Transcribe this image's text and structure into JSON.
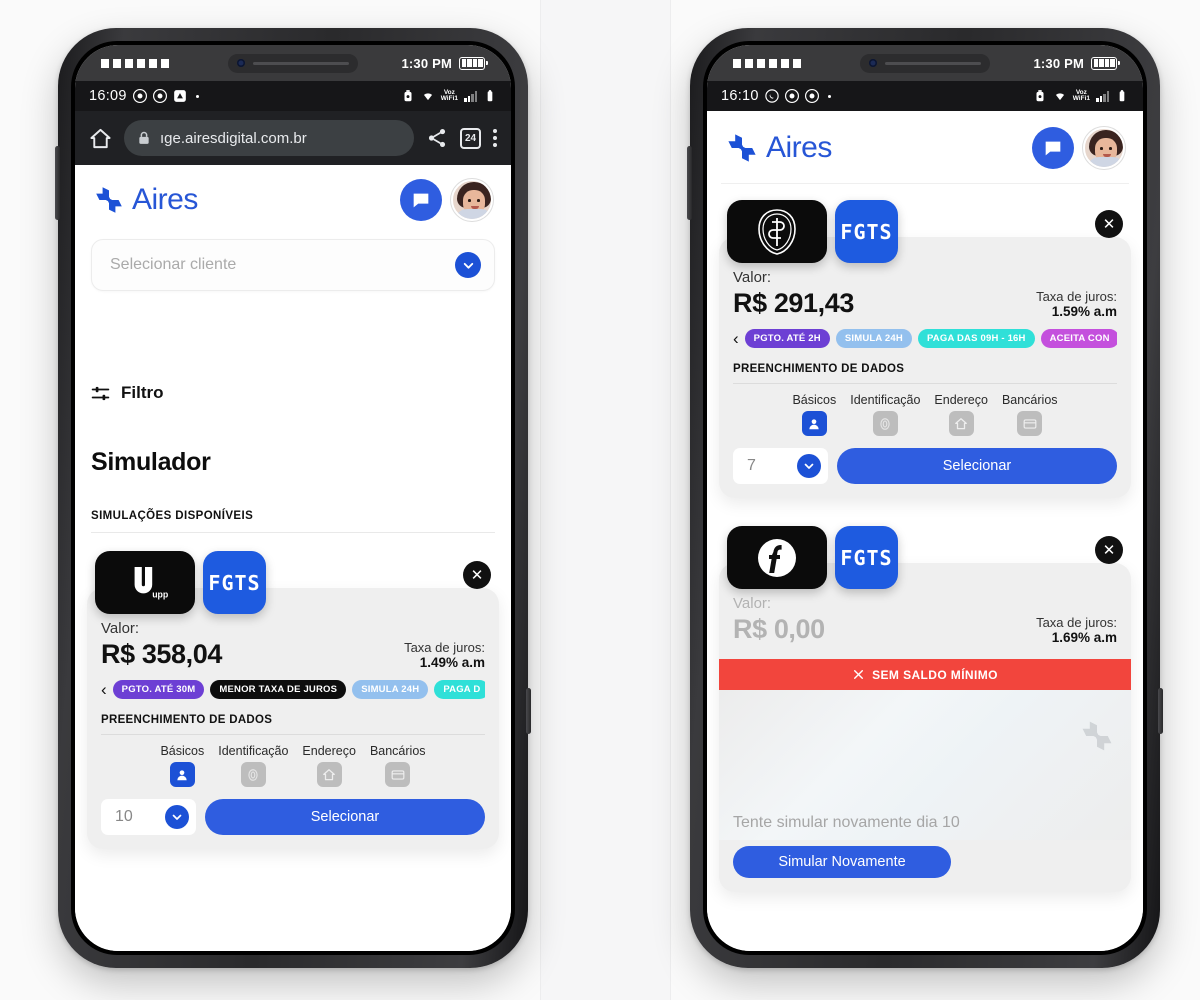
{
  "left_phone": {
    "device_status": {
      "time": "1:30 PM",
      "battery_icon": "battery-full-icon"
    },
    "android_status": {
      "time": "16:09",
      "icons": [
        "chrome-icon",
        "chrome-icon",
        "app-icon"
      ],
      "right_icons": [
        "alarm-icon",
        "wifi-icon",
        "voice-wifi-icon",
        "signal-icon",
        "battery-icon"
      ],
      "voz_label": "Voz",
      "wifi_label": "WiFi1"
    },
    "browser": {
      "home_icon": "home-icon",
      "lock_icon": "lock-icon",
      "url": "ıge.airesdigital.com.br",
      "share_icon": "share-icon",
      "tab_count": "24",
      "menu_icon": "kebab-menu-icon"
    },
    "app": {
      "brand": "Aires",
      "logo_icon": "aires-pinwheel-logo",
      "chat_icon": "chat-bubble-icon",
      "avatar_icon": "user-avatar",
      "client_select": {
        "placeholder": "Selecionar cliente",
        "chevron_icon": "chevron-down-icon"
      },
      "filter": {
        "label": "Filtro",
        "icon": "filter-sliders-icon"
      },
      "page_title": "Simulador",
      "section_caption": "SIMULAÇÕES DISPONÍVEIS",
      "offer": {
        "bank_logo": "upp-logo",
        "bank_name": "upp",
        "product_logo": "fgts-logo",
        "product_name": "FGTS",
        "close_icon": "close-icon",
        "value_label": "Valor:",
        "value": "R$ 358,04",
        "rate_label": "Taxa de juros:",
        "rate": "1.49% a.m",
        "prev_icon": "chevron-left-icon",
        "next_icon": "chevron-right-icon",
        "tags": [
          {
            "label": "PGTO. ATÉ 30M",
            "color": "#6d3fd4"
          },
          {
            "label": "MENOR TAXA DE JUROS",
            "color": "#0d0d0d"
          },
          {
            "label": "SIMULA 24H",
            "color": "#93c0ee"
          },
          {
            "label": "PAGA D",
            "color": "#2fe0d8"
          }
        ],
        "fill_title": "PREENCHIMENTO DE DADOS",
        "steps": [
          {
            "label": "Básicos",
            "icon": "person-icon",
            "active": true
          },
          {
            "label": "Identificação",
            "icon": "fingerprint-icon",
            "active": false
          },
          {
            "label": "Endereço",
            "icon": "home-icon",
            "active": false
          },
          {
            "label": "Bancários",
            "icon": "card-icon",
            "active": false
          }
        ],
        "installments": "10",
        "installments_chevron": "chevron-down-icon",
        "cta": "Selecionar"
      }
    }
  },
  "right_phone": {
    "device_status": {
      "time": "1:30 PM",
      "battery_icon": "battery-full-icon"
    },
    "android_status": {
      "time": "16:10",
      "icons": [
        "whatsapp-icon",
        "chrome-icon",
        "chrome-icon"
      ],
      "voz_label": "Voz",
      "wifi_label": "WiFi1"
    },
    "app": {
      "brand": "Aires",
      "logo_icon": "aires-pinwheel-logo",
      "chat_icon": "chat-bubble-icon",
      "avatar_icon": "user-avatar",
      "offer1": {
        "bank_logo": "bb-crest-logo",
        "product_logo": "fgts-logo",
        "product_name": "FGTS",
        "close_icon": "close-icon",
        "value_label": "Valor:",
        "value": "R$ 291,43",
        "rate_label": "Taxa de juros:",
        "rate": "1.59% a.m",
        "prev_icon": "chevron-left-icon",
        "next_icon": "chevron-right-icon",
        "tags": [
          {
            "label": "PGTO. ATÉ 2H",
            "color": "#6d3fd4"
          },
          {
            "label": "SIMULA 24H",
            "color": "#93c0ee"
          },
          {
            "label": "PAGA DAS 09H - 16H",
            "color": "#2fe0d8"
          },
          {
            "label": "ACEITA CON",
            "color": "#c450dd"
          }
        ],
        "fill_title": "PREENCHIMENTO DE DADOS",
        "steps": [
          {
            "label": "Básicos",
            "icon": "person-icon",
            "active": true
          },
          {
            "label": "Identificação",
            "icon": "fingerprint-icon",
            "active": false
          },
          {
            "label": "Endereço",
            "icon": "home-icon",
            "active": false
          },
          {
            "label": "Bancários",
            "icon": "card-icon",
            "active": false
          }
        ],
        "installments": "7",
        "installments_chevron": "chevron-down-icon",
        "cta": "Selecionar"
      },
      "offer2": {
        "bank_logo": "facta-logo",
        "product_logo": "fgts-logo",
        "product_name": "FGTS",
        "close_icon": "close-icon",
        "value_label": "Valor:",
        "value": "R$ 0,00",
        "rate_label": "Taxa de juros:",
        "rate": "1.69% a.m",
        "alert_icon": "x-icon",
        "alert_text": "SEM SALDO MÍNIMO",
        "alert_color": "#f2453d",
        "blurred_text": "Tente simular novamente dia 10",
        "watermark_icon": "aires-pinwheel-logo",
        "cta": "Simular Novamente"
      }
    }
  }
}
